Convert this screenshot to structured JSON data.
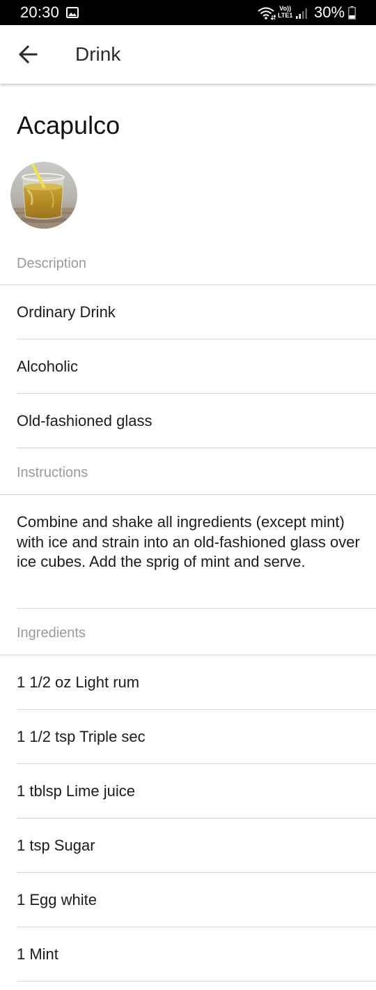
{
  "status_bar": {
    "time": "20:30",
    "network_label_line1": "Vo))",
    "network_label_line2": "LTE1",
    "battery_percent": "30%",
    "battery_level": 0.3,
    "icons": [
      "gallery-icon",
      "wifi-icon",
      "signal-icon",
      "battery-icon"
    ]
  },
  "app_bar": {
    "title": "Drink",
    "back_icon": "arrow-back-icon"
  },
  "drink": {
    "name": "Acapulco",
    "image": "cocktail-photo"
  },
  "description": {
    "header": "Description",
    "items": [
      "Ordinary Drink",
      "Alcoholic",
      "Old-fashioned glass"
    ]
  },
  "instructions": {
    "header": "Instructions",
    "text": "Combine and shake all ingredients (except mint) with ice and strain into an old-fashioned glass over ice cubes. Add the sprig of mint and serve."
  },
  "ingredients": {
    "header": "Ingredients",
    "items": [
      "1 1/2 oz Light rum",
      "1 1/2 tsp Triple sec",
      "1 tblsp Lime juice",
      "1 tsp Sugar",
      "1 Egg white",
      "1 Mint"
    ]
  },
  "colors": {
    "status_bar_bg": "#000000",
    "section_header": "#9a9a9a",
    "divider": "#d7d7d7",
    "text": "#1c1c1c"
  }
}
